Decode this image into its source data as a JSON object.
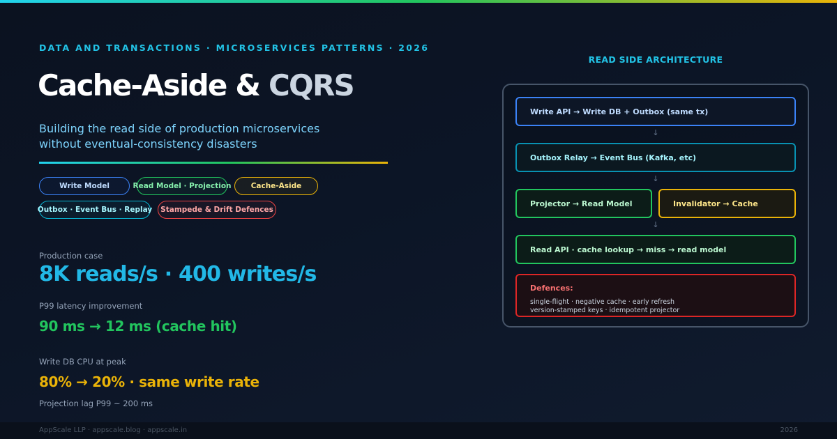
{
  "colors": {
    "accent_cyan": "#22c3e6",
    "accent_green": "#22c55e",
    "accent_yellow": "#eab308",
    "accent_red": "#ef4444",
    "background": "#0b1220"
  },
  "eyebrow": "DATA AND TRANSACTIONS · MICROSERVICES PATTERNS · 2026",
  "title": {
    "part1": "Cache-Aside & ",
    "part2": "CQRS"
  },
  "subtitle": {
    "line1": "Building the read side of production microservices",
    "line2": "without eventual-consistency disasters"
  },
  "tags": [
    {
      "label": "Write Model",
      "color": "blue"
    },
    {
      "label": "Read Model · Projection",
      "color": "green"
    },
    {
      "label": "Cache-Aside",
      "color": "yellow"
    },
    {
      "label": "Outbox · Event Bus · Replay",
      "color": "cyan"
    },
    {
      "label": "Stampede & Drift Defences",
      "color": "red"
    }
  ],
  "metrics": {
    "production_label": "Production case",
    "production_value": "8K reads/s · 400 writes/s",
    "latency_label": "P99 latency improvement",
    "latency_value": "90 ms → 12 ms (cache hit)",
    "cpu_label": "Write DB CPU at peak",
    "cpu_value": "80% → 20% · same write rate",
    "lag_note": "Projection lag P99 ~ 200 ms"
  },
  "architecture": {
    "title": "READ SIDE ARCHITECTURE",
    "write_api": "Write API → Write DB + Outbox (same tx)",
    "outbox_relay": "Outbox Relay → Event Bus (Kafka, etc)",
    "projector": "Projector → Read Model",
    "invalidator": "Invalidator → Cache",
    "read_api": "Read API · cache lookup → miss → read model",
    "defences_title": "Defences:",
    "defences_line1": "single-flight · negative cache · early refresh",
    "defences_line2": "version-stamped keys · idempotent projector",
    "arrow": "↓"
  },
  "footer": {
    "left": "AppScale LLP · appscale.blog · appscale.in",
    "right": "2026"
  }
}
